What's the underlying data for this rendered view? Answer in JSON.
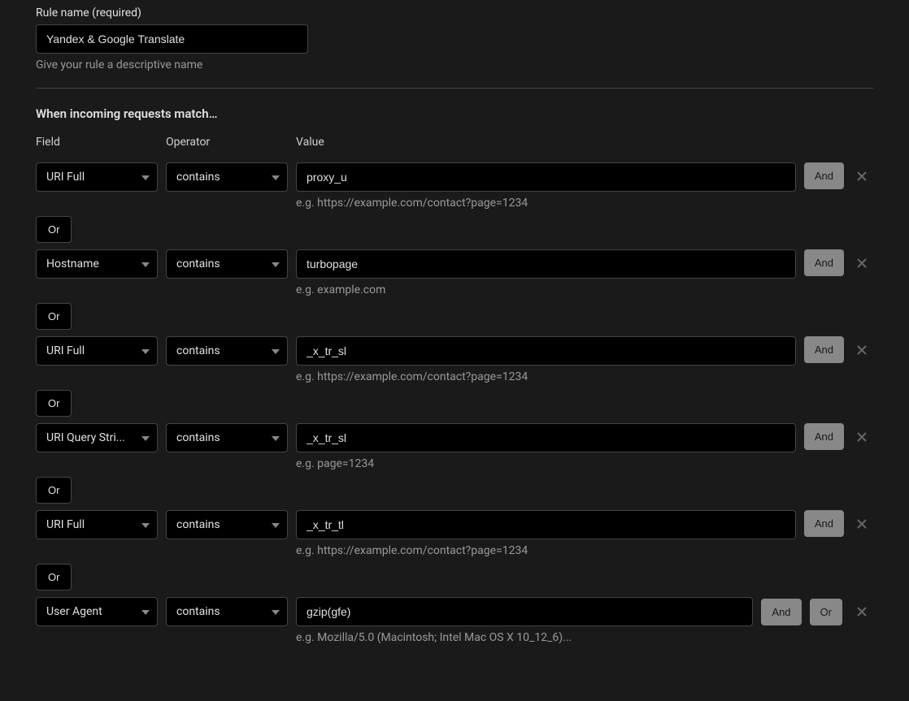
{
  "ruleName": {
    "label": "Rule name (required)",
    "value": "Yandex & Google Translate",
    "helper": "Give your rule a descriptive name"
  },
  "sectionHeader": "When incoming requests match…",
  "headers": {
    "field": "Field",
    "operator": "Operator",
    "value": "Value"
  },
  "buttons": {
    "and": "And",
    "or": "Or"
  },
  "rules": [
    {
      "field": "URI Full",
      "operator": "contains",
      "value": "proxy_u",
      "hint": "e.g. https://example.com/contact?page=1234",
      "actions": [
        "and"
      ],
      "connector": "Or"
    },
    {
      "field": "Hostname",
      "operator": "contains",
      "value": "turbopage",
      "hint": "e.g. example.com",
      "actions": [
        "and"
      ],
      "connector": "Or"
    },
    {
      "field": "URI Full",
      "operator": "contains",
      "value": "_x_tr_sl",
      "hint": "e.g. https://example.com/contact?page=1234",
      "actions": [
        "and"
      ],
      "connector": "Or"
    },
    {
      "field": "URI Query Stri...",
      "operator": "contains",
      "value": "_x_tr_sl",
      "hint": "e.g. page=1234",
      "actions": [
        "and"
      ],
      "connector": "Or"
    },
    {
      "field": "URI Full",
      "operator": "contains",
      "value": "_x_tr_tl",
      "hint": "e.g. https://example.com/contact?page=1234",
      "actions": [
        "and"
      ],
      "connector": "Or"
    },
    {
      "field": "User Agent",
      "operator": "contains",
      "value": "gzip(gfe)",
      "hint": "e.g. Mozilla/5.0 (Macintosh; Intel Mac OS X 10_12_6)...",
      "actions": [
        "and",
        "or"
      ],
      "connector": null
    }
  ]
}
